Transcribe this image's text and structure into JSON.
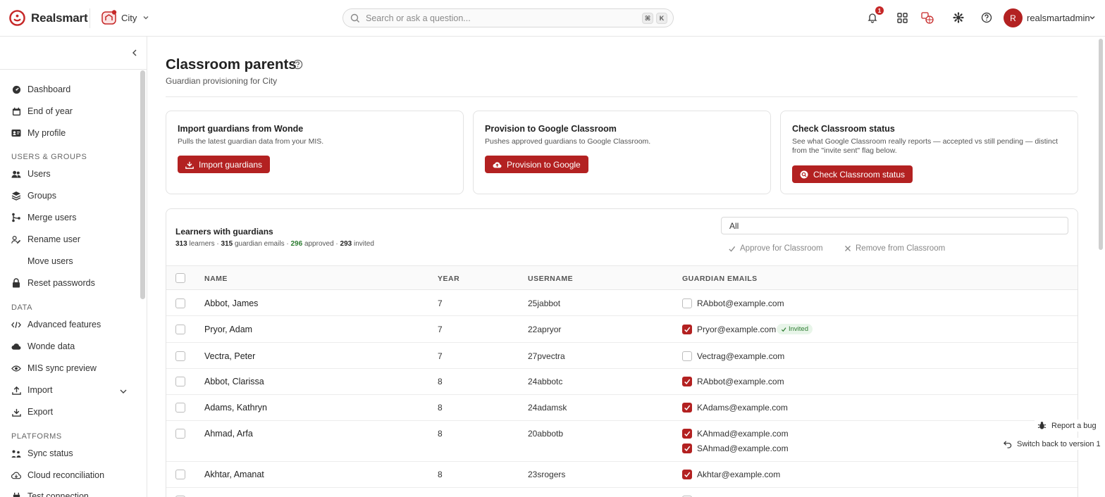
{
  "app": {
    "brand": "Realsmart",
    "school": "City",
    "search_placeholder": "Search or ask a question...",
    "kbd_cmd": "⌘",
    "kbd_k": "K",
    "notification_count": "1",
    "user_initial": "R",
    "user_name": "realsmartadmin"
  },
  "sidebar": {
    "items_top": [
      {
        "label": "Dashboard",
        "icon": "dashboard-icon"
      },
      {
        "label": "End of year",
        "icon": "calendar-icon"
      },
      {
        "label": "My profile",
        "icon": "id-card-icon"
      }
    ],
    "section_users": "USERS & GROUPS",
    "items_users": [
      {
        "label": "Users",
        "icon": "users-icon"
      },
      {
        "label": "Groups",
        "icon": "layers-icon"
      },
      {
        "label": "Merge users",
        "icon": "merge-icon"
      },
      {
        "label": "Rename user",
        "icon": "user-edit-icon"
      },
      {
        "label": "Move users",
        "icon": ""
      },
      {
        "label": "Reset passwords",
        "icon": "lock-icon"
      }
    ],
    "section_data": "DATA",
    "items_data": [
      {
        "label": "Advanced features",
        "icon": "code-icon"
      },
      {
        "label": "Wonde data",
        "icon": "cloud-icon"
      },
      {
        "label": "MIS sync preview",
        "icon": "eye-icon"
      },
      {
        "label": "Import",
        "icon": "upload-icon"
      },
      {
        "label": "Export",
        "icon": "download-icon"
      }
    ],
    "section_platforms": "PLATFORMS",
    "items_platforms": [
      {
        "label": "Sync status",
        "icon": "sync-icon"
      },
      {
        "label": "Cloud reconciliation",
        "icon": "cloud-sync-icon"
      },
      {
        "label": "Test connection",
        "icon": "plug-icon"
      }
    ]
  },
  "page": {
    "title": "Classroom parents",
    "subtitle": "Guardian provisioning for City"
  },
  "cards": [
    {
      "title": "Import guardians from Wonde",
      "desc": "Pulls the latest guardian data from your MIS.",
      "button": "Import guardians"
    },
    {
      "title": "Provision to Google Classroom",
      "desc": "Pushes approved guardians to Google Classroom.",
      "button": "Provision to Google"
    },
    {
      "title": "Check Classroom status",
      "desc": "See what Google Classroom really reports — accepted vs still pending — distinct from the \"invite sent\" flag below.",
      "button": "Check Classroom status"
    }
  ],
  "table": {
    "title": "Learners with guardians",
    "stats": {
      "learners": "313",
      "learners_label": "learners ·",
      "emails": "315",
      "emails_label": "guardian emails ·",
      "approved": "296",
      "approved_label": "approved ·",
      "invited": "293",
      "invited_label": "invited"
    },
    "filter_value": "All",
    "approve_label": "Approve for Classroom",
    "remove_label": "Remove from Classroom",
    "headers": [
      "NAME",
      "YEAR",
      "USERNAME",
      "GUARDIAN EMAILS"
    ],
    "invited_badge": "Invited",
    "rows": [
      {
        "name": "Abbot, James",
        "year": "7",
        "username": "25jabbot",
        "emails": [
          {
            "email": "RAbbot@example.com",
            "approved": false,
            "invited": false
          }
        ]
      },
      {
        "name": "Pryor, Adam",
        "year": "7",
        "username": "22apryor",
        "emails": [
          {
            "email": "Pryor@example.com",
            "approved": true,
            "invited": true
          }
        ]
      },
      {
        "name": "Vectra, Peter",
        "year": "7",
        "username": "27pvectra",
        "emails": [
          {
            "email": "Vectrag@example.com",
            "approved": false,
            "invited": false
          }
        ]
      },
      {
        "name": "Abbot, Clarissa",
        "year": "8",
        "username": "24abbotc",
        "emails": [
          {
            "email": "RAbbot@example.com",
            "approved": true,
            "invited": false
          }
        ]
      },
      {
        "name": "Adams, Kathryn",
        "year": "8",
        "username": "24adamsk",
        "emails": [
          {
            "email": "KAdams@example.com",
            "approved": true,
            "invited": false
          }
        ]
      },
      {
        "name": "Ahmad, Arfa",
        "year": "8",
        "username": "20abbotb",
        "emails": [
          {
            "email": "KAhmad@example.com",
            "approved": true,
            "invited": false
          },
          {
            "email": "SAhmad@example.com",
            "approved": true,
            "invited": false
          }
        ]
      },
      {
        "name": "Akhtar, Amanat",
        "year": "8",
        "username": "23srogers",
        "emails": [
          {
            "email": "Akhtar@example.com",
            "approved": true,
            "invited": false
          }
        ]
      }
    ]
  },
  "floaters": {
    "report_bug": "Report a bug",
    "switch_back": "Switch back to version 1"
  },
  "colors": {
    "accent": "#b32121",
    "success": "#2e7d32"
  }
}
